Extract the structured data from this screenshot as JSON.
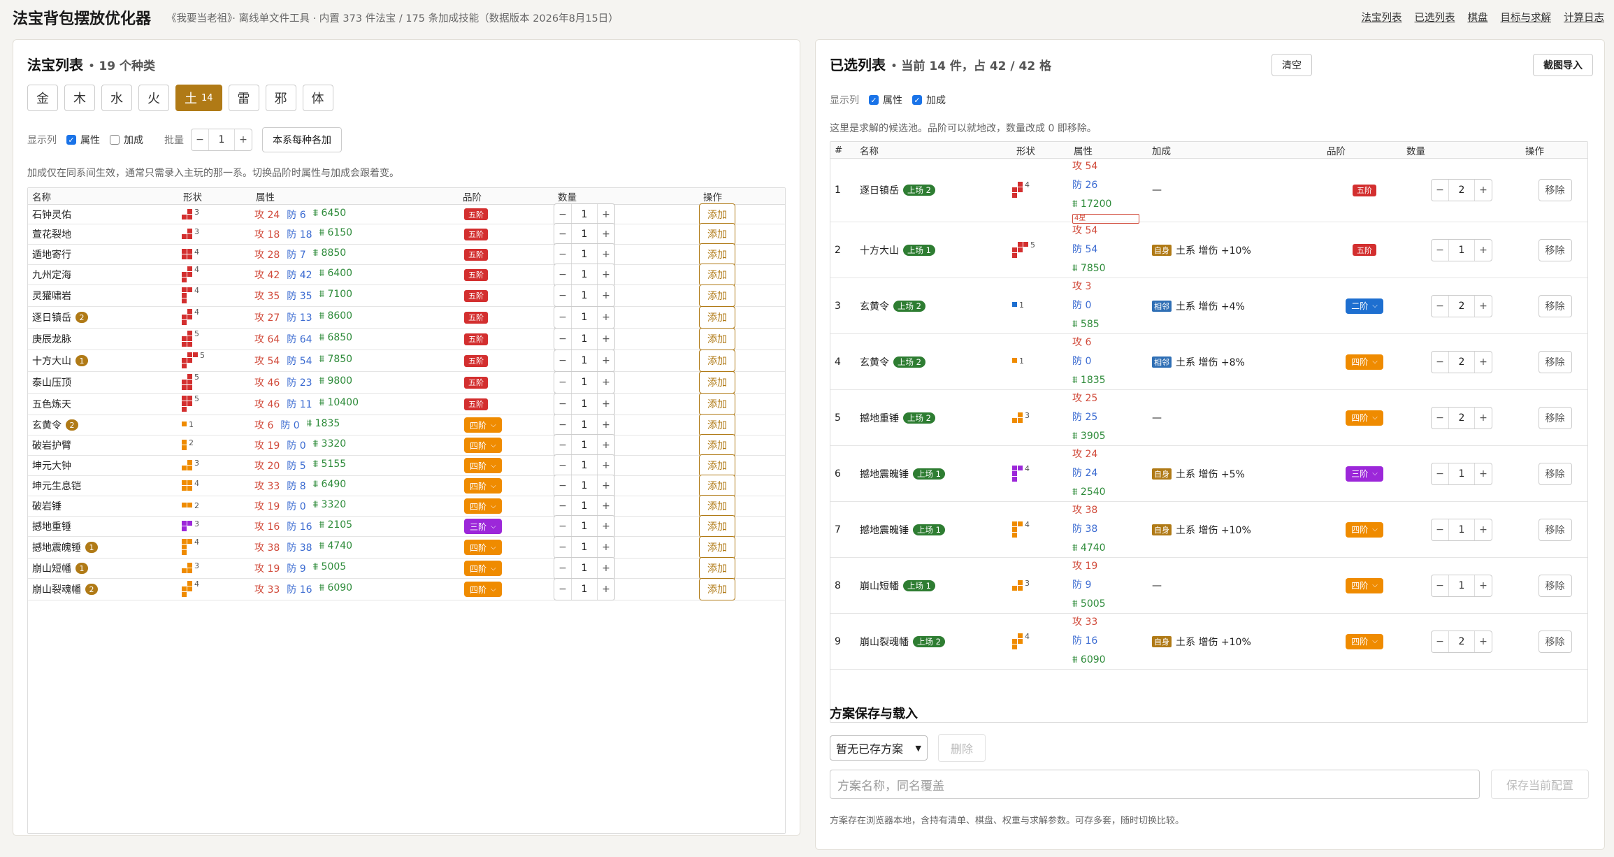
{
  "header": {
    "title": "法宝背包摆放优化器",
    "subtitle": "《我要当老祖》· 离线单文件工具 · 内置 373 件法宝 / 175 条加成技能（数据版本 2026年8月15日）",
    "nav": [
      "法宝列表",
      "已选列表",
      "棋盘",
      "目标与求解",
      "计算日志"
    ]
  },
  "colors": {
    "accent": "#b07a16",
    "five": "#d32f2f",
    "four": "#ef8b00",
    "three": "#9c27d9",
    "two": "#1e6fd0",
    "on_stage": "#2e7d32",
    "self": "#b07a16",
    "adjacent": "#2f6fb5"
  },
  "left": {
    "title": "法宝列表",
    "count_text": "19 个种类",
    "tabs": [
      {
        "label": "金",
        "count": ""
      },
      {
        "label": "木",
        "count": ""
      },
      {
        "label": "水",
        "count": ""
      },
      {
        "label": "火",
        "count": ""
      },
      {
        "label": "土",
        "count": "14"
      },
      {
        "label": "雷",
        "count": ""
      },
      {
        "label": "邪",
        "count": ""
      },
      {
        "label": "体",
        "count": ""
      }
    ],
    "display_label": "显示列",
    "attr_label": "属性",
    "bonus_label": "加成",
    "batch_label": "批量",
    "batch_value": "1",
    "add_each_label": "本系每种各加",
    "note": "加成仅在同系间生效，通常只需录入主玩的那一系。切换品阶时属性与加成会跟着变。",
    "columns": [
      "名称",
      "形状",
      "属性",
      "品阶",
      "数量",
      "操作"
    ],
    "add_label": "添加",
    "rows": [
      {
        "name": "石钟灵佑",
        "badge": "",
        "shape": "s3a",
        "color": "#d32f2f",
        "n": "3",
        "atk": "攻 24",
        "def": "防 6",
        "hp": "6450",
        "tier": "五阶",
        "tiercolor": "#d32f2f",
        "sel": false,
        "qty": "1"
      },
      {
        "name": "萱花裂地",
        "badge": "",
        "shape": "s3b",
        "color": "#d32f2f",
        "n": "3",
        "atk": "攻 18",
        "def": "防 18",
        "hp": "6150",
        "tier": "五阶",
        "tiercolor": "#d32f2f",
        "sel": false,
        "qty": "1"
      },
      {
        "name": "遁地寄行",
        "badge": "",
        "shape": "s4a",
        "color": "#d32f2f",
        "n": "4",
        "atk": "攻 28",
        "def": "防 7",
        "hp": "8850",
        "tier": "五阶",
        "tiercolor": "#d32f2f",
        "sel": false,
        "qty": "1"
      },
      {
        "name": "九州定海",
        "badge": "",
        "shape": "s4b",
        "color": "#d32f2f",
        "n": "4",
        "atk": "攻 42",
        "def": "防 42",
        "hp": "6400",
        "tier": "五阶",
        "tiercolor": "#d32f2f",
        "sel": false,
        "qty": "1"
      },
      {
        "name": "灵獾啸岩",
        "badge": "",
        "shape": "s4c",
        "color": "#d32f2f",
        "n": "4",
        "atk": "攻 35",
        "def": "防 35",
        "hp": "7100",
        "tier": "五阶",
        "tiercolor": "#d32f2f",
        "sel": false,
        "qty": "1"
      },
      {
        "name": "逐日镇岳",
        "badge": "2",
        "shape": "s4b",
        "color": "#d32f2f",
        "n": "4",
        "atk": "攻 27",
        "def": "防 13",
        "hp": "8600",
        "tier": "五阶",
        "tiercolor": "#d32f2f",
        "sel": false,
        "qty": "1"
      },
      {
        "name": "庚辰龙脉",
        "badge": "",
        "shape": "s5a",
        "color": "#d32f2f",
        "n": "5",
        "atk": "攻 64",
        "def": "防 64",
        "hp": "6850",
        "tier": "五阶",
        "tiercolor": "#d32f2f",
        "sel": false,
        "qty": "1"
      },
      {
        "name": "十方大山",
        "badge": "1",
        "shape": "s5b",
        "color": "#d32f2f",
        "n": "5",
        "atk": "攻 54",
        "def": "防 54",
        "hp": "7850",
        "tier": "五阶",
        "tiercolor": "#d32f2f",
        "sel": false,
        "qty": "1"
      },
      {
        "name": "泰山压顶",
        "badge": "",
        "shape": "s5c",
        "color": "#d32f2f",
        "n": "5",
        "atk": "攻 46",
        "def": "防 23",
        "hp": "9800",
        "tier": "五阶",
        "tiercolor": "#d32f2f",
        "sel": false,
        "qty": "1"
      },
      {
        "name": "五色炼天",
        "badge": "",
        "shape": "s5d",
        "color": "#d32f2f",
        "n": "5",
        "atk": "攻 46",
        "def": "防 11",
        "hp": "10400",
        "tier": "五阶",
        "tiercolor": "#d32f2f",
        "sel": false,
        "qty": "1"
      },
      {
        "name": "玄黄令",
        "badge": "2",
        "shape": "s1",
        "color": "#ef8b00",
        "n": "1",
        "atk": "攻 6",
        "def": "防 0",
        "hp": "1835",
        "tier": "四阶",
        "tiercolor": "#ef8b00",
        "sel": true,
        "qty": "1"
      },
      {
        "name": "破岩护臂",
        "badge": "",
        "shape": "s2v",
        "color": "#ef8b00",
        "n": "2",
        "atk": "攻 19",
        "def": "防 0",
        "hp": "3320",
        "tier": "四阶",
        "tiercolor": "#ef8b00",
        "sel": true,
        "qty": "1"
      },
      {
        "name": "坤元大钟",
        "badge": "",
        "shape": "s3c",
        "color": "#ef8b00",
        "n": "3",
        "atk": "攻 20",
        "def": "防 5",
        "hp": "5155",
        "tier": "四阶",
        "tiercolor": "#ef8b00",
        "sel": true,
        "qty": "1"
      },
      {
        "name": "坤元生息铠",
        "badge": "",
        "shape": "s4d",
        "color": "#ef8b00",
        "n": "4",
        "atk": "攻 33",
        "def": "防 8",
        "hp": "6490",
        "tier": "四阶",
        "tiercolor": "#ef8b00",
        "sel": true,
        "qty": "1"
      },
      {
        "name": "破岩锤",
        "badge": "",
        "shape": "s2h",
        "color": "#ef8b00",
        "n": "2",
        "atk": "攻 19",
        "def": "防 0",
        "hp": "3320",
        "tier": "四阶",
        "tiercolor": "#ef8b00",
        "sel": true,
        "qty": "1"
      },
      {
        "name": "撼地重锤",
        "badge": "",
        "shape": "s3d",
        "color": "#9c27d9",
        "n": "3",
        "atk": "攻 16",
        "def": "防 16",
        "hp": "2105",
        "tier": "三阶",
        "tiercolor": "#9c27d9",
        "sel": true,
        "qty": "1"
      },
      {
        "name": "撼地震魄锤",
        "badge": "1",
        "shape": "s4e",
        "color": "#ef8b00",
        "n": "4",
        "atk": "攻 38",
        "def": "防 38",
        "hp": "4740",
        "tier": "四阶",
        "tiercolor": "#ef8b00",
        "sel": true,
        "qty": "1"
      },
      {
        "name": "崩山短幡",
        "badge": "1",
        "shape": "s3c",
        "color": "#ef8b00",
        "n": "3",
        "atk": "攻 19",
        "def": "防 9",
        "hp": "5005",
        "tier": "四阶",
        "tiercolor": "#ef8b00",
        "sel": true,
        "qty": "1"
      },
      {
        "name": "崩山裂魂幡",
        "badge": "2",
        "shape": "s4f",
        "color": "#ef8b00",
        "n": "4",
        "atk": "攻 33",
        "def": "防 16",
        "hp": "6090",
        "tier": "四阶",
        "tiercolor": "#ef8b00",
        "sel": true,
        "qty": "1"
      }
    ]
  },
  "right": {
    "title": "已选列表",
    "summary": "当前 14 件，占 42 / 42 格",
    "clear_label": "清空",
    "import_label": "截图导入",
    "display_label": "显示列",
    "attr_label": "属性",
    "bonus_label": "加成",
    "note": "这里是求解的候选池。品阶可以就地改，数量改成 0 即移除。",
    "columns": [
      "#",
      "名称",
      "形状",
      "属性",
      "加成",
      "品阶",
      "数量",
      "操作"
    ],
    "remove_label": "移除",
    "none_text": "—",
    "rows": [
      {
        "idx": "1",
        "name": "逐日镇岳",
        "on": "上场 2",
        "shape": "s4b",
        "color": "#d32f2f",
        "n": "4",
        "atk": "攻 54",
        "def": "防 26",
        "hp": "17200",
        "extra": "4星",
        "bonus_tag": "",
        "bonus_text": "—",
        "tier": "五阶",
        "tiercolor": "#d32f2f",
        "sel": false,
        "qty": "2"
      },
      {
        "idx": "2",
        "name": "十方大山",
        "on": "上场 1",
        "shape": "s5b",
        "color": "#d32f2f",
        "n": "5",
        "atk": "攻 54",
        "def": "防 54",
        "hp": "7850",
        "extra": "",
        "bonus_tag": "自身",
        "bonus_tagcolor": "#b07a16",
        "bonus_text": "土系 增伤 +10%",
        "tier": "五阶",
        "tiercolor": "#d32f2f",
        "sel": false,
        "qty": "1"
      },
      {
        "idx": "3",
        "name": "玄黄令",
        "on": "上场 2",
        "shape": "s1",
        "color": "#1e6fd0",
        "n": "1",
        "atk": "攻 3",
        "def": "防 0",
        "hp": "585",
        "extra": "",
        "bonus_tag": "相邻",
        "bonus_tagcolor": "#2f6fb5",
        "bonus_text": "土系 增伤 +4%",
        "tier": "二阶",
        "tiercolor": "#1e6fd0",
        "sel": true,
        "qty": "2"
      },
      {
        "idx": "4",
        "name": "玄黄令",
        "on": "上场 2",
        "shape": "s1",
        "color": "#ef8b00",
        "n": "1",
        "atk": "攻 6",
        "def": "防 0",
        "hp": "1835",
        "extra": "",
        "bonus_tag": "相邻",
        "bonus_tagcolor": "#2f6fb5",
        "bonus_text": "土系 增伤 +8%",
        "tier": "四阶",
        "tiercolor": "#ef8b00",
        "sel": true,
        "qty": "2"
      },
      {
        "idx": "5",
        "name": "撼地重锤",
        "on": "上场 2",
        "shape": "s3c",
        "color": "#ef8b00",
        "n": "3",
        "atk": "攻 25",
        "def": "防 25",
        "hp": "3905",
        "extra": "",
        "bonus_tag": "",
        "bonus_text": "—",
        "tier": "四阶",
        "tiercolor": "#ef8b00",
        "sel": true,
        "qty": "2"
      },
      {
        "idx": "6",
        "name": "撼地震魄锤",
        "on": "上场 1",
        "shape": "s4e",
        "color": "#9c27d9",
        "n": "4",
        "atk": "攻 24",
        "def": "防 24",
        "hp": "2540",
        "extra": "",
        "bonus_tag": "自身",
        "bonus_tagcolor": "#b07a16",
        "bonus_text": "土系 增伤 +5%",
        "tier": "三阶",
        "tiercolor": "#9c27d9",
        "sel": true,
        "qty": "1"
      },
      {
        "idx": "7",
        "name": "撼地震魄锤",
        "on": "上场 1",
        "shape": "s4e",
        "color": "#ef8b00",
        "n": "4",
        "atk": "攻 38",
        "def": "防 38",
        "hp": "4740",
        "extra": "",
        "bonus_tag": "自身",
        "bonus_tagcolor": "#b07a16",
        "bonus_text": "土系 增伤 +10%",
        "tier": "四阶",
        "tiercolor": "#ef8b00",
        "sel": true,
        "qty": "1"
      },
      {
        "idx": "8",
        "name": "崩山短幡",
        "on": "上场 1",
        "shape": "s3c",
        "color": "#ef8b00",
        "n": "3",
        "atk": "攻 19",
        "def": "防 9",
        "hp": "5005",
        "extra": "",
        "bonus_tag": "",
        "bonus_text": "—",
        "tier": "四阶",
        "tiercolor": "#ef8b00",
        "sel": true,
        "qty": "1"
      },
      {
        "idx": "9",
        "name": "崩山裂魂幡",
        "on": "上场 2",
        "shape": "s4f",
        "color": "#ef8b00",
        "n": "4",
        "atk": "攻 33",
        "def": "防 16",
        "hp": "6090",
        "extra": "",
        "bonus_tag": "自身",
        "bonus_tagcolor": "#b07a16",
        "bonus_text": "土系 增伤 +10%",
        "tier": "四阶",
        "tiercolor": "#ef8b00",
        "sel": true,
        "qty": "2"
      }
    ],
    "save": {
      "title": "方案保存与载入",
      "select_value": "暂无已存方案",
      "delete_label": "删除",
      "name_placeholder": "方案名称，同名覆盖",
      "save_label": "保存当前配置",
      "note": "方案存在浏览器本地，含持有清单、棋盘、权重与求解参数。可存多套，随时切换比较。"
    }
  }
}
